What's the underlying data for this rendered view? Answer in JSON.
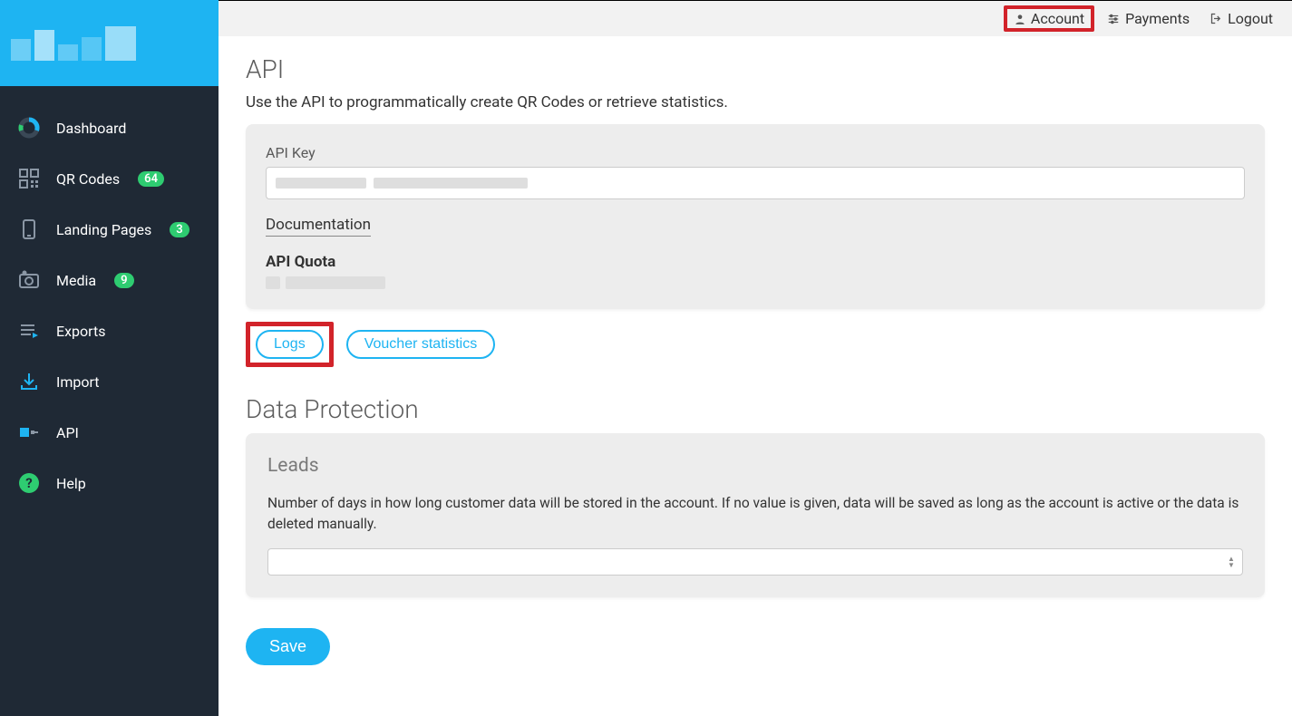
{
  "topbar": {
    "account": "Account",
    "payments": "Payments",
    "logout": "Logout"
  },
  "sidebar": {
    "items": [
      {
        "label": "Dashboard"
      },
      {
        "label": "QR Codes",
        "badge": "64"
      },
      {
        "label": "Landing Pages",
        "badge": "3"
      },
      {
        "label": "Media",
        "badge": "9"
      },
      {
        "label": "Exports"
      },
      {
        "label": "Import"
      },
      {
        "label": "API"
      },
      {
        "label": "Help"
      }
    ]
  },
  "api": {
    "title": "API",
    "subtitle": "Use the API to programmatically create QR Codes or retrieve statistics.",
    "key_label": "API Key",
    "key_value": "",
    "doc_link": "Documentation",
    "quota_title": "API Quota",
    "logs_btn": "Logs",
    "voucher_btn": "Voucher statistics"
  },
  "protection": {
    "title": "Data Protection",
    "leads_title": "Leads",
    "leads_desc": "Number of days in how long customer data will be stored in the account. If no value is given, data will be saved as long as the account is active or the data is deleted manually.",
    "leads_value": ""
  },
  "save_label": "Save"
}
